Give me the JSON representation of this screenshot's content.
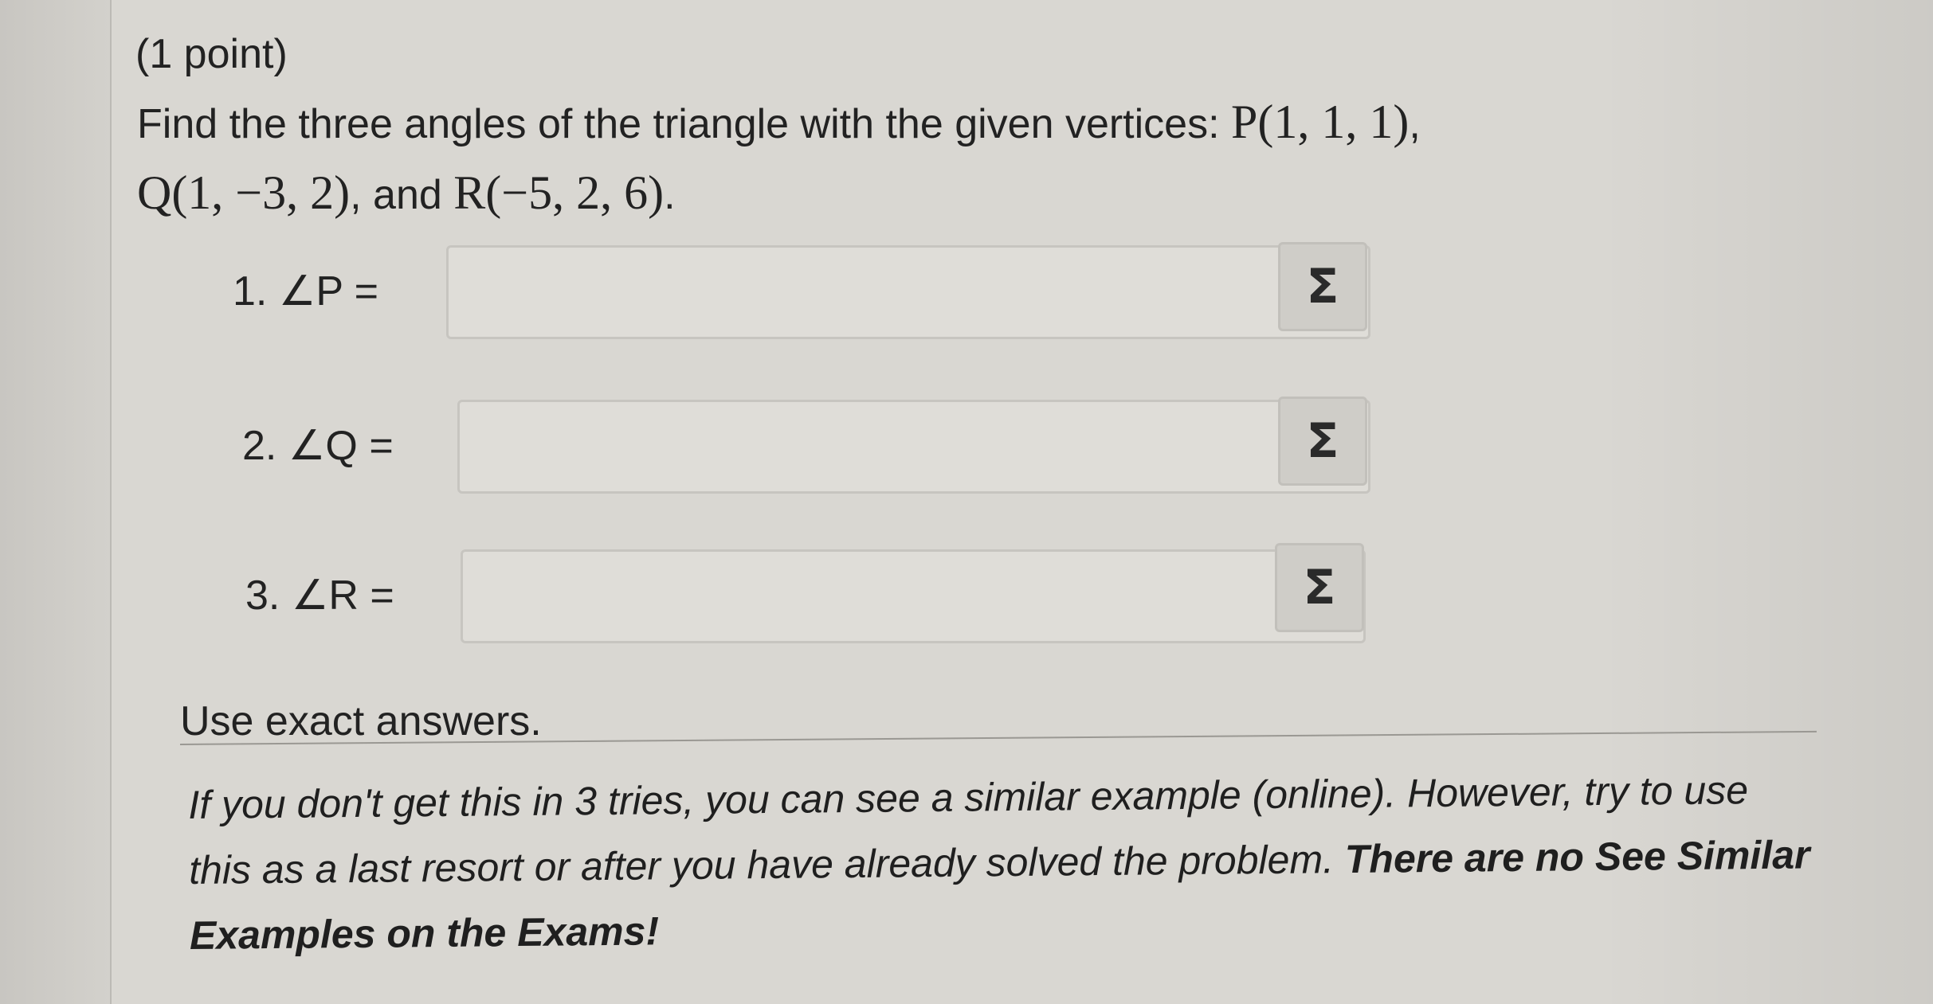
{
  "problem": {
    "points_label": "(1 point)",
    "intro_text": "Find the three angles of the triangle with the given vertices: ",
    "vertex_p": "P(1, 1, 1)",
    "sep1": ",",
    "vertex_q": "Q(1, −3, 2)",
    "and_text": ", and ",
    "vertex_r": "R(−5, 2, 6)",
    "end": "."
  },
  "answers": [
    {
      "label": "1. ∠P =",
      "value": "",
      "button": "Σ"
    },
    {
      "label": "2. ∠Q =",
      "value": "",
      "button": "Σ"
    },
    {
      "label": "3. ∠R =",
      "value": "",
      "button": "Σ"
    }
  ],
  "instructions": "Use exact answers.",
  "note": {
    "text": "If you don't get this in 3 tries, you can see a similar example (online). However, try to use this as a last resort or after you have already solved the problem. ",
    "bold": "There are no See Similar Examples on the Exams!"
  }
}
